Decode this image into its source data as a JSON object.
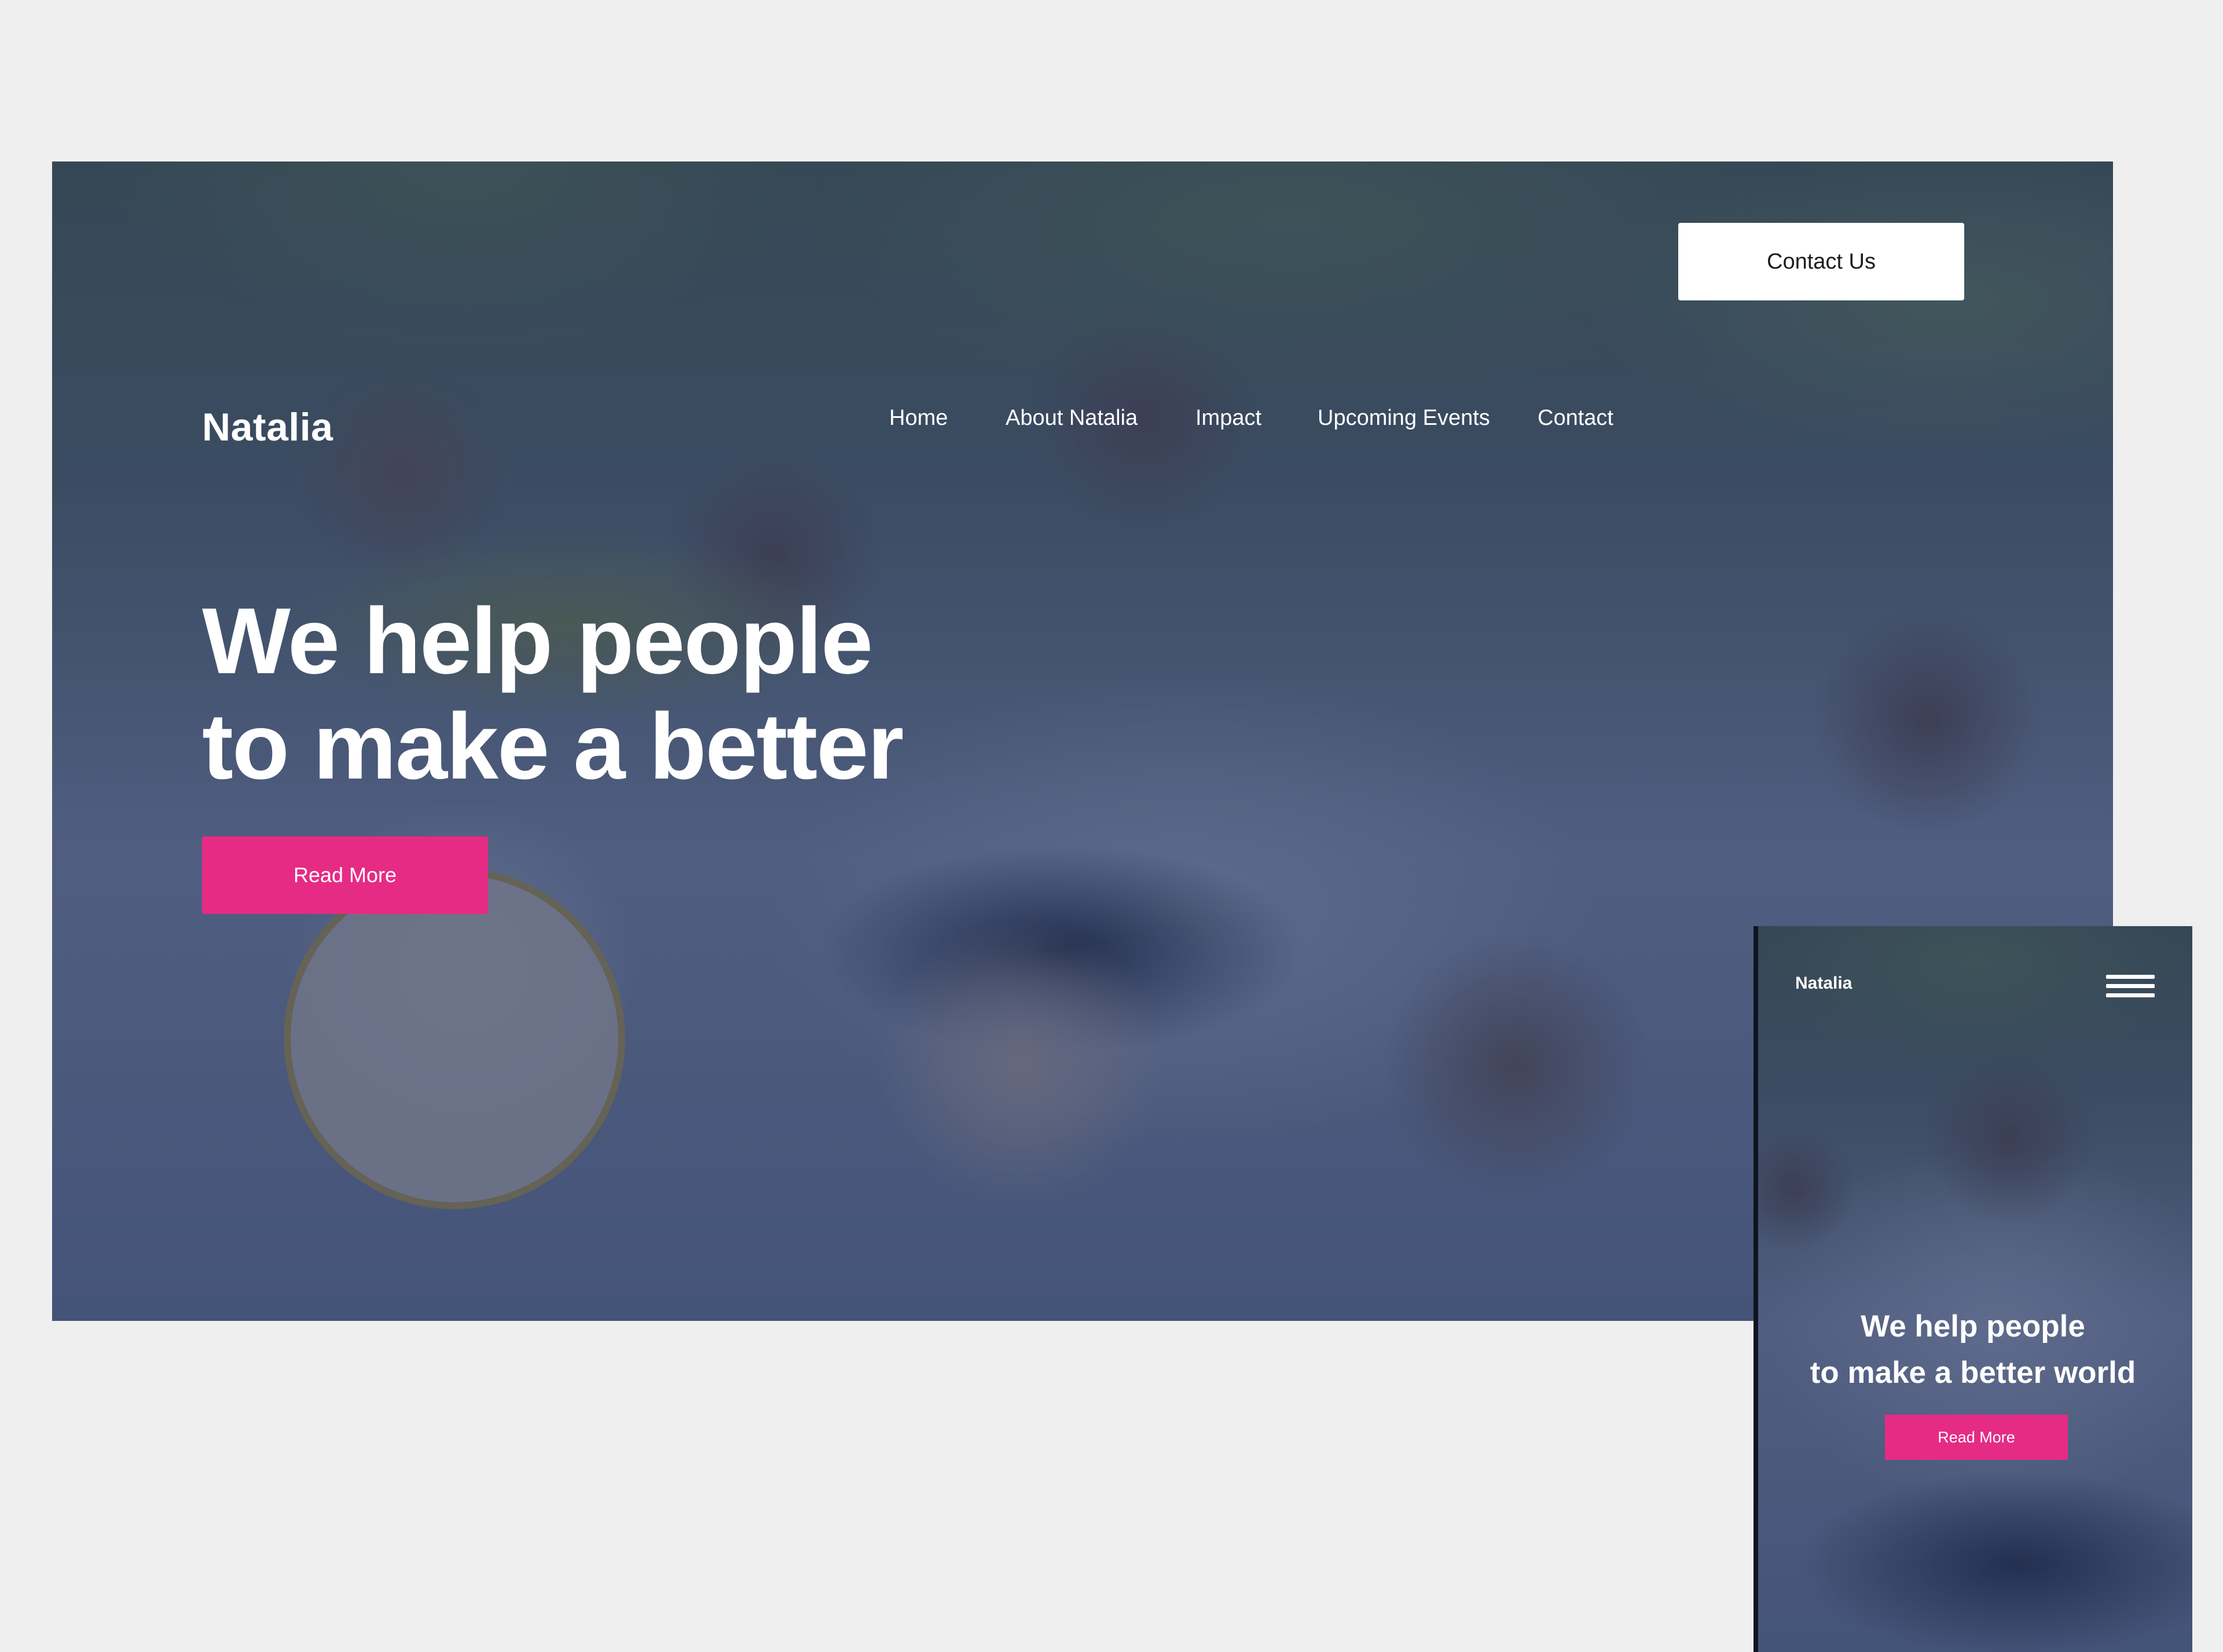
{
  "desktop": {
    "brand": "Natalia",
    "nav": [
      {
        "label": "Home"
      },
      {
        "label": "About Natalia"
      },
      {
        "label": "Impact"
      },
      {
        "label": "Upcoming Events"
      },
      {
        "label": "Contact"
      }
    ],
    "contact_button": "Contact Us",
    "hero": {
      "line1": "We help people",
      "line2": "to make a better",
      "button": "Read More"
    }
  },
  "mobile": {
    "brand": "Natalia",
    "menu_icon": "hamburger-menu-icon",
    "hero": {
      "line1": "We help people",
      "line2": "to make a better world",
      "button": "Read More"
    }
  },
  "colors": {
    "background": "#efefef",
    "overlay": "#2a3862",
    "accent": "#e62b85",
    "text": "#ffffff"
  }
}
